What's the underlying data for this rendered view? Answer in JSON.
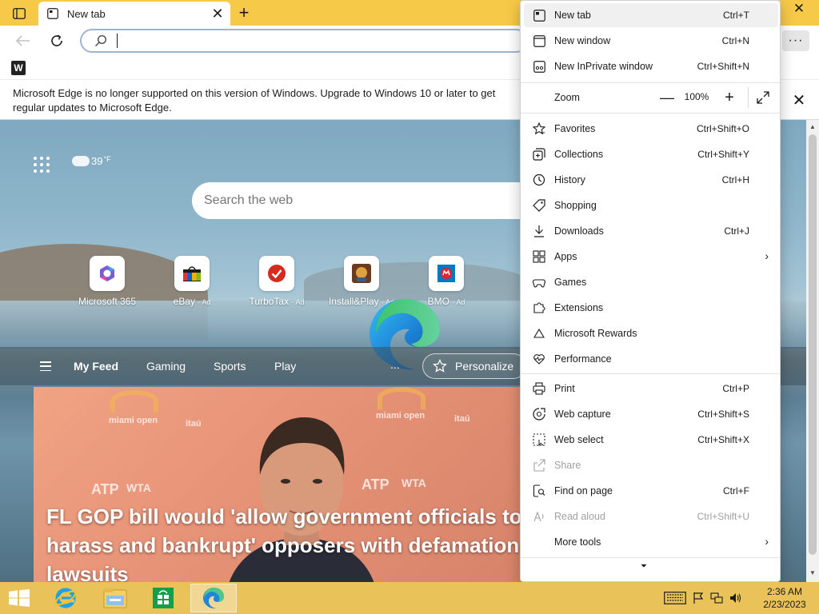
{
  "window": {
    "tab_title": "New tab",
    "close_glyph": "✕"
  },
  "toolbar": {
    "address_value": "",
    "more_glyph": "···"
  },
  "favorites": {
    "item_glyph": "W"
  },
  "infobar": {
    "message": "Microsoft Edge is no longer supported on this version of Windows. Upgrade to Windows 10 or later to get regular updates to Microsoft Edge."
  },
  "newtab": {
    "weather": {
      "temp": "39",
      "unit": "°F"
    },
    "search_placeholder": "Search the web",
    "quick_links": [
      {
        "label": "Microsoft 365",
        "ad": ""
      },
      {
        "label": "eBay",
        "ad": "· Ad"
      },
      {
        "label": "TurboTax",
        "ad": "· Ad"
      },
      {
        "label": "Install&Play",
        "ad": "· Ad"
      },
      {
        "label": "BMO",
        "ad": "· Ad"
      }
    ],
    "feed_tabs": [
      "My Feed",
      "Gaming",
      "Sports",
      "Play"
    ],
    "feed_more": "...",
    "personalize": "Personalize",
    "news_headline": "FL GOP bill would 'allow government officials to harass and bankrupt' opposers with defamation lawsuits",
    "news_bg_text": [
      "miami open",
      "itaú",
      "ATP",
      "WTA"
    ]
  },
  "menu": {
    "items": [
      {
        "label": "New tab",
        "shortcut": "Ctrl+T",
        "icon": "new-tab-icon"
      },
      {
        "label": "New window",
        "shortcut": "Ctrl+N",
        "icon": "new-window-icon"
      },
      {
        "label": "New InPrivate window",
        "shortcut": "Ctrl+Shift+N",
        "icon": "inprivate-icon"
      },
      {
        "label": "Favorites",
        "shortcut": "Ctrl+Shift+O",
        "icon": "star-icon"
      },
      {
        "label": "Collections",
        "shortcut": "Ctrl+Shift+Y",
        "icon": "collections-icon"
      },
      {
        "label": "History",
        "shortcut": "Ctrl+H",
        "icon": "history-icon"
      },
      {
        "label": "Shopping",
        "shortcut": "",
        "icon": "tag-icon"
      },
      {
        "label": "Downloads",
        "shortcut": "Ctrl+J",
        "icon": "download-icon"
      },
      {
        "label": "Apps",
        "shortcut": "",
        "icon": "apps-icon"
      },
      {
        "label": "Games",
        "shortcut": "",
        "icon": "games-icon"
      },
      {
        "label": "Extensions",
        "shortcut": "",
        "icon": "puzzle-icon"
      },
      {
        "label": "Microsoft Rewards",
        "shortcut": "",
        "icon": "rewards-icon"
      },
      {
        "label": "Performance",
        "shortcut": "",
        "icon": "heartbeat-icon"
      },
      {
        "label": "Print",
        "shortcut": "Ctrl+P",
        "icon": "printer-icon"
      },
      {
        "label": "Web capture",
        "shortcut": "Ctrl+Shift+S",
        "icon": "capture-icon"
      },
      {
        "label": "Web select",
        "shortcut": "Ctrl+Shift+X",
        "icon": "select-icon"
      },
      {
        "label": "Share",
        "shortcut": "",
        "icon": "share-icon"
      },
      {
        "label": "Find on page",
        "shortcut": "Ctrl+F",
        "icon": "find-icon"
      },
      {
        "label": "Read aloud",
        "shortcut": "Ctrl+Shift+U",
        "icon": "read-aloud-icon"
      },
      {
        "label": "More tools",
        "shortcut": "",
        "icon": ""
      }
    ],
    "zoom": {
      "label": "Zoom",
      "value": "100%",
      "minus": "—",
      "plus": "+"
    },
    "more_glyph": "⏷"
  },
  "taskbar": {
    "time": "2:36 AM",
    "date": "2/23/2023"
  },
  "colors": {
    "titlebar": "#f7c948",
    "taskbar": "#e9c25a",
    "accent": "#0078d4"
  }
}
